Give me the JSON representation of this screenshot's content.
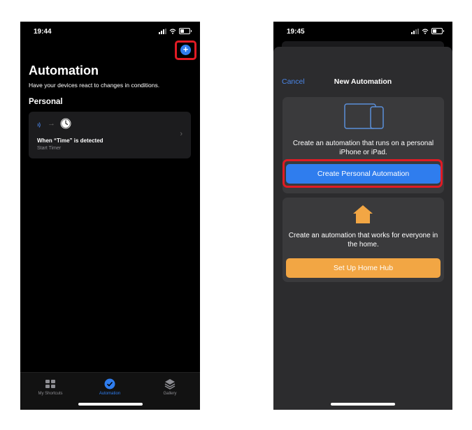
{
  "left": {
    "status_time": "19:44",
    "title": "Automation",
    "subtitle": "Have your devices react to changes in conditions.",
    "section": "Personal",
    "card": {
      "trigger": "When “Time” is detected",
      "action": "Start Timer"
    },
    "tabs": [
      {
        "label": "My Shortcuts",
        "icon": "grid-icon"
      },
      {
        "label": "Automation",
        "icon": "automation-check-icon"
      },
      {
        "label": "Gallery",
        "icon": "layers-icon"
      }
    ],
    "accent": "#2f7dee",
    "highlight": "#e01b24"
  },
  "right": {
    "status_time": "19:45",
    "cancel": "Cancel",
    "title": "New Automation",
    "personal": {
      "text": "Create an automation that runs on a personal iPhone or iPad.",
      "button": "Create Personal Automation"
    },
    "home": {
      "text": "Create an automation that works for everyone in the home.",
      "button": "Set Up Home Hub"
    },
    "colors": {
      "blue_button": "#2f7dee",
      "orange_button": "#f2a644"
    }
  }
}
